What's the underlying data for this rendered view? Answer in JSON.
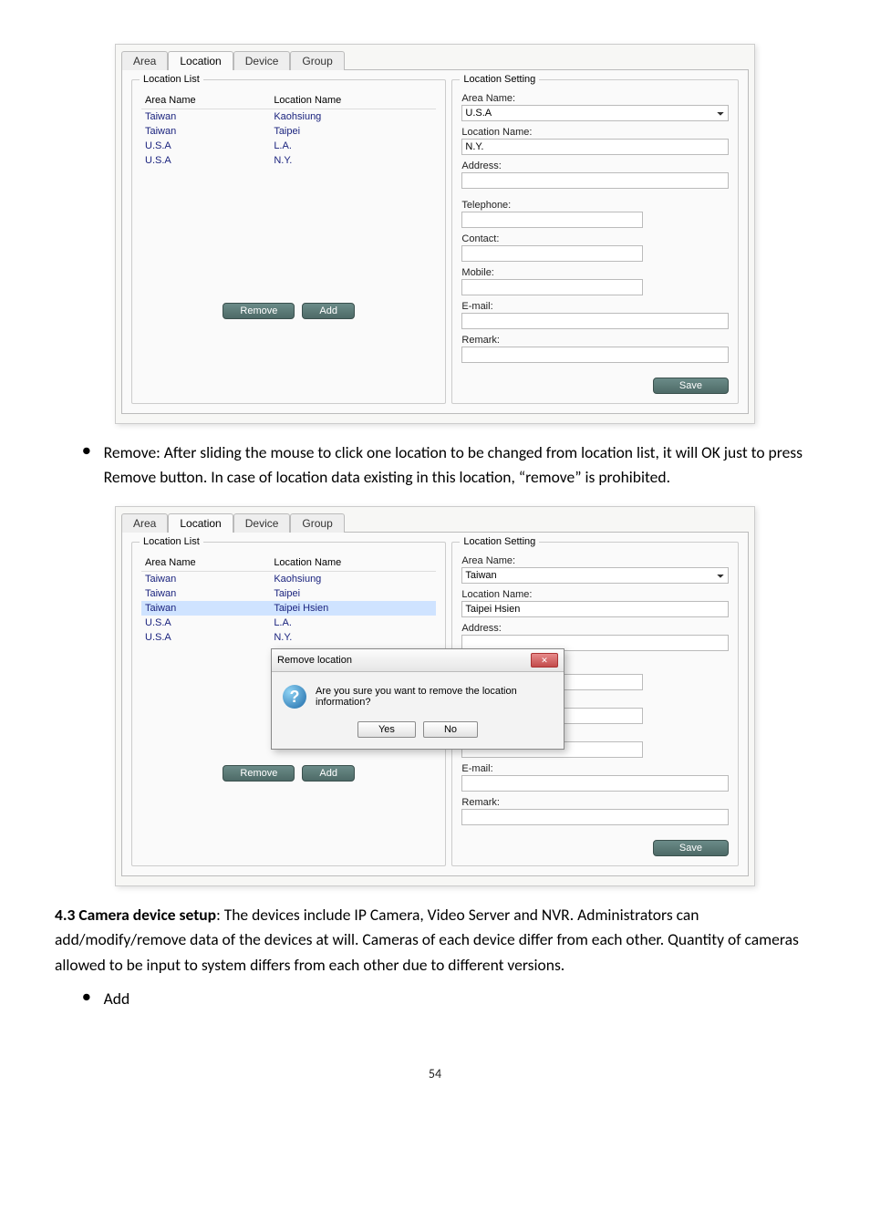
{
  "tabs": {
    "area": "Area",
    "location": "Location",
    "device": "Device",
    "group": "Group"
  },
  "group_titles": {
    "list": "Location List",
    "setting": "Location Setting"
  },
  "list_headers": {
    "area": "Area Name",
    "location": "Location Name"
  },
  "buttons": {
    "remove": "Remove",
    "add": "Add",
    "save": "Save",
    "yes": "Yes",
    "no": "No"
  },
  "setting_labels": {
    "area_name": "Area Name:",
    "location_name": "Location Name:",
    "address": "Address:",
    "telephone": "Telephone:",
    "contact": "Contact:",
    "mobile": "Mobile:",
    "email": "E-mail:",
    "remark": "Remark:"
  },
  "screenshot1": {
    "rows": [
      {
        "area": "Taiwan",
        "location": "Kaohsiung"
      },
      {
        "area": "Taiwan",
        "location": "Taipei"
      },
      {
        "area": "U.S.A",
        "location": "L.A."
      },
      {
        "area": "U.S.A",
        "location": "N.Y."
      }
    ],
    "setting": {
      "area_name": "U.S.A",
      "location_name": "N.Y."
    }
  },
  "screenshot2": {
    "rows": [
      {
        "area": "Taiwan",
        "location": "Kaohsiung"
      },
      {
        "area": "Taiwan",
        "location": "Taipei"
      },
      {
        "area": "Taiwan",
        "location": "Taipei Hsien",
        "selected": true
      },
      {
        "area": "U.S.A",
        "location": "L.A."
      },
      {
        "area": "U.S.A",
        "location": "N.Y."
      }
    ],
    "setting": {
      "area_name": "Taiwan",
      "location_name": "Taipei Hsien"
    },
    "dialog": {
      "title": "Remove location",
      "message": "Are you sure you want to remove the location information?"
    }
  },
  "text": {
    "bullet_remove": "Remove: After sliding the mouse to click one location to be changed from location list, it will OK just to press Remove button. In case of location data existing in this location, “remove” is prohibited.",
    "section_43_bold": "4.3 Camera device setup",
    "section_43_rest": ": The devices include IP Camera, Video Server and NVR. Administrators can add/modify/remove data of the devices at will. Cameras of each device differ from each other. Quantity of cameras allowed to be input to system differs from each other due to different versions.",
    "bullet_add": "Add",
    "pagenum": "54"
  }
}
